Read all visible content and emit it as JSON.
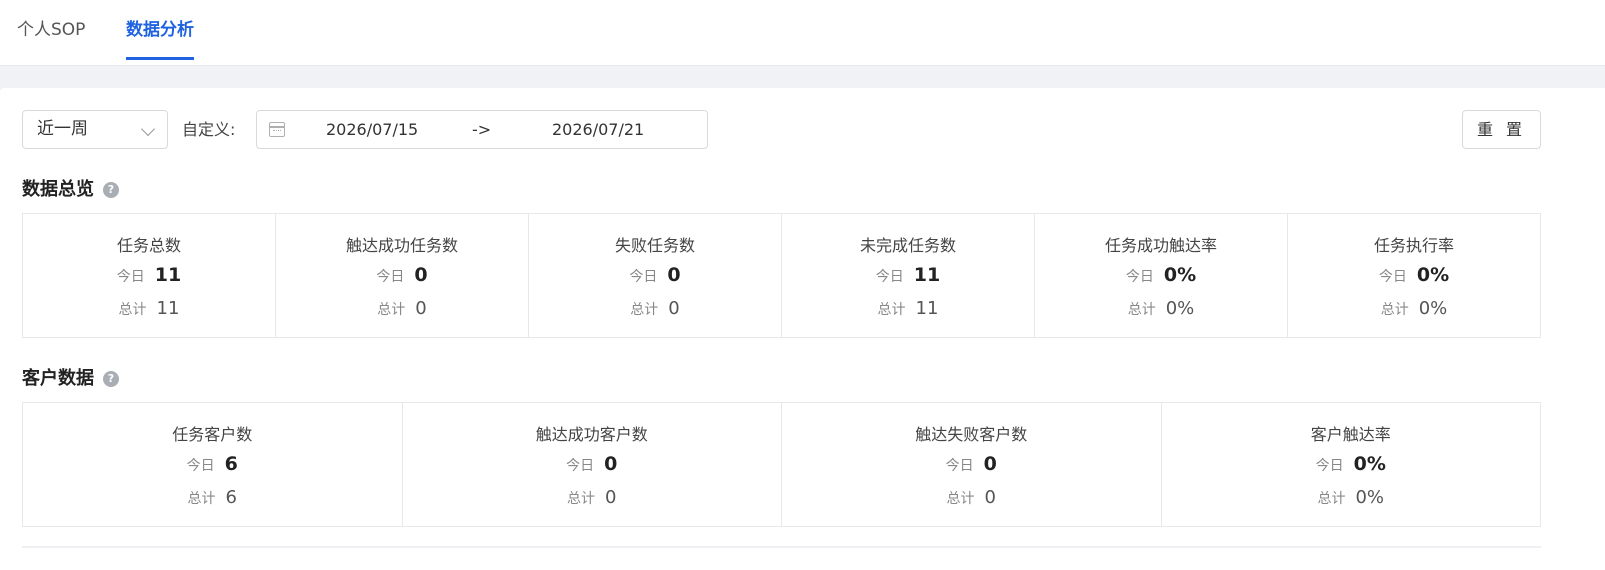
{
  "tabs": [
    {
      "label": "个人SOP",
      "active": false
    },
    {
      "label": "数据分析",
      "active": true
    }
  ],
  "filter": {
    "period": "近一周",
    "custom_label": "自定义:",
    "start_date": "2026/07/15",
    "arrow": "->",
    "end_date": "2026/07/21",
    "reset_label": "重 置"
  },
  "overview": {
    "title": "数据总览",
    "help": "?",
    "today_label": "今日",
    "total_label": "总计",
    "metrics": [
      {
        "label": "任务总数",
        "today": "11",
        "total": "11"
      },
      {
        "label": "触达成功任务数",
        "today": "0",
        "total": "0"
      },
      {
        "label": "失败任务数",
        "today": "0",
        "total": "0"
      },
      {
        "label": "未完成任务数",
        "today": "11",
        "total": "11"
      },
      {
        "label": "任务成功触达率",
        "today": "0%",
        "total": "0%"
      },
      {
        "label": "任务执行率",
        "today": "0%",
        "total": "0%"
      }
    ]
  },
  "customers": {
    "title": "客户数据",
    "help": "?",
    "today_label": "今日",
    "total_label": "总计",
    "metrics": [
      {
        "label": "任务客户数",
        "today": "6",
        "total": "6"
      },
      {
        "label": "触达成功客户数",
        "today": "0",
        "total": "0"
      },
      {
        "label": "触达失败客户数",
        "today": "0",
        "total": "0"
      },
      {
        "label": "客户触达率",
        "today": "0%",
        "total": "0%"
      }
    ]
  },
  "colors": {
    "accent": "#1f63e0"
  }
}
